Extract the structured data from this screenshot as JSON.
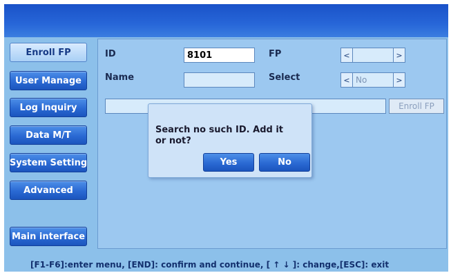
{
  "menu": {
    "items": [
      {
        "label": "Enroll FP",
        "active": true
      },
      {
        "label": "User Manage",
        "active": false
      },
      {
        "label": "Log Inquiry",
        "active": false
      },
      {
        "label": "Data M/T",
        "active": false
      },
      {
        "label": "System Setting",
        "active": false
      },
      {
        "label": "Advanced",
        "active": false
      }
    ],
    "main_interface": "Main interface"
  },
  "form": {
    "id_label": "ID",
    "id_value": "8101",
    "name_label": "Name",
    "name_value": "",
    "fp_label": "FP",
    "fp_value": "",
    "select_label": "Select",
    "select_value": "No",
    "prev_glyph": "<",
    "next_glyph": ">",
    "enroll_button": "Enroll FP"
  },
  "dialog": {
    "message": "Search no such ID. Add it or not?",
    "yes": "Yes",
    "no": "No"
  },
  "footer": {
    "hint": "[F1-F6]:enter menu, [END]: confirm and continue, [ ↑ ↓ ]: change,[ESC]: exit"
  }
}
